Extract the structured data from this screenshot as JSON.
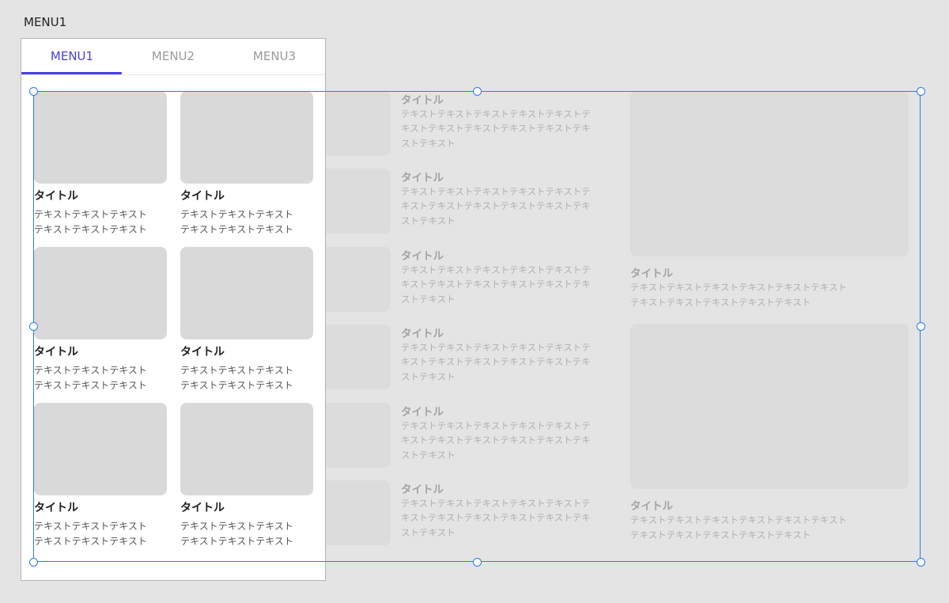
{
  "artboard": {
    "label": "MENU1"
  },
  "tabs": [
    {
      "label": "MENU1",
      "active": true
    },
    {
      "label": "MENU2",
      "active": false
    },
    {
      "label": "MENU3",
      "active": false
    }
  ],
  "colors": {
    "accent": "#4a3ee0",
    "selection": "#2c7bf0",
    "placeholder": "#d9d9d9"
  },
  "cards": [
    {
      "title": "タイトル",
      "line1": "テキストテキストテキスト",
      "line2": "テキストテキストテキスト"
    },
    {
      "title": "タイトル",
      "line1": "テキストテキストテキスト",
      "line2": "テキストテキストテキスト"
    },
    {
      "title": "タイトル",
      "line1": "テキストテキストテキスト",
      "line2": "テキストテキストテキスト"
    },
    {
      "title": "タイトル",
      "line1": "テキストテキストテキスト",
      "line2": "テキストテキストテキスト"
    },
    {
      "title": "タイトル",
      "line1": "テキストテキストテキスト",
      "line2": "テキストテキストテキスト"
    },
    {
      "title": "タイトル",
      "line1": "テキストテキストテキスト",
      "line2": "テキストテキストテキスト"
    }
  ],
  "list_ghost": [
    {
      "title": "タイトル",
      "line1": "テキストテキストテキストテキストテキストテ",
      "line2": "キストテキストテキストテキストテキストテキ",
      "line3": "ストテキスト"
    },
    {
      "title": "タイトル",
      "line1": "テキストテキストテキストテキストテキストテ",
      "line2": "キストテキストテキストテキストテキストテキ",
      "line3": "ストテキスト"
    },
    {
      "title": "タイトル",
      "line1": "テキストテキストテキストテキストテキストテ",
      "line2": "キストテキストテキストテキストテキストテキ",
      "line3": "ストテキスト"
    },
    {
      "title": "タイトル",
      "line1": "テキストテキストテキストテキストテキストテ",
      "line2": "キストテキストテキストテキストテキストテキ",
      "line3": "ストテキスト"
    },
    {
      "title": "タイトル",
      "line1": "テキストテキストテキストテキストテキストテ",
      "line2": "キストテキストテキストテキストテキストテキ",
      "line3": "ストテキスト"
    },
    {
      "title": "タイトル",
      "line1": "テキストテキストテキストテキストテキストテ",
      "line2": "キストテキストテキストテキストテキストテキ",
      "line3": "ストテキスト"
    }
  ],
  "large_ghost": [
    {
      "title": "タイトル",
      "line1": "テキストテキストテキストテキストテキストテキスト",
      "line2": "テキストテキストテキストテキストテキスト"
    },
    {
      "title": "タイトル",
      "line1": "テキストテキストテキストテキストテキストテキスト",
      "line2": "テキストテキストテキストテキストテキスト"
    }
  ]
}
